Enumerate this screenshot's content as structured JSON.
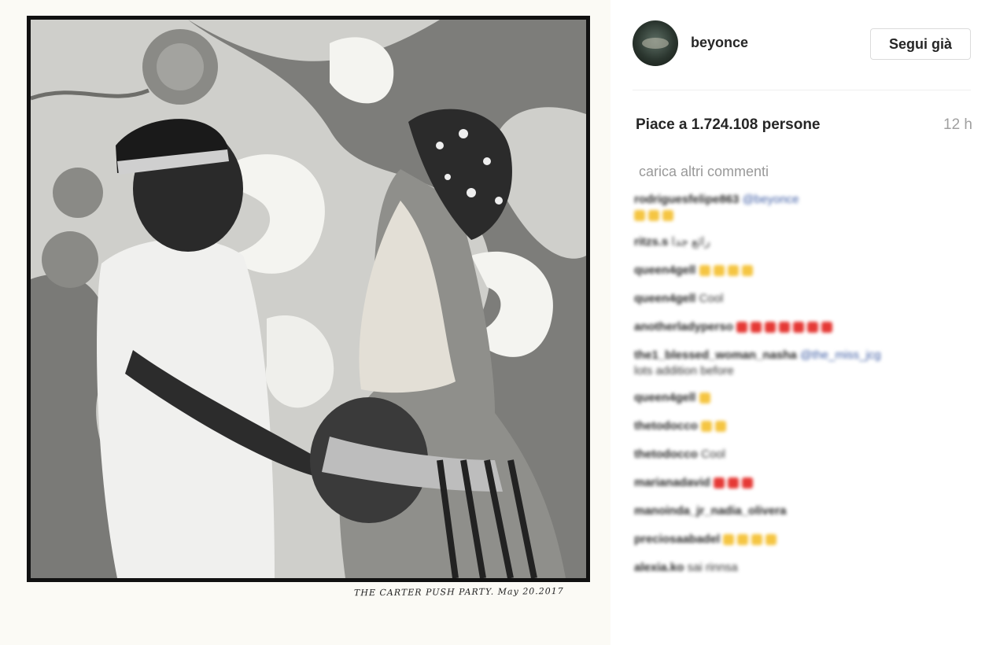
{
  "photo": {
    "caption": "THE CARTER PUSH PARTY. May 20.2017"
  },
  "post": {
    "username": "beyonce",
    "follow_label": "Segui già",
    "likes_text": "Piace a 1.724.108 persone",
    "time": "12 h",
    "load_more": "carica altri commenti"
  },
  "comments": [
    {
      "user": "rodriguesfelipe863",
      "mention": "@beyonce",
      "text": "",
      "emoji_color": "#f5c542",
      "emoji_count": 3,
      "two_lines": true
    },
    {
      "user": "ritzs.s",
      "mention": "",
      "text": "رائع جدا",
      "emoji_color": "",
      "emoji_count": 0,
      "two_lines": false
    },
    {
      "user": "queen4gell",
      "mention": "",
      "text": "",
      "emoji_color": "#f5c542",
      "emoji_count": 4,
      "two_lines": false
    },
    {
      "user": "queen4gell",
      "mention": "",
      "text": "Cool",
      "emoji_color": "",
      "emoji_count": 0,
      "two_lines": false
    },
    {
      "user": "anotherladyperso",
      "mention": "",
      "text": "",
      "emoji_color": "#e53935",
      "emoji_count": 7,
      "two_lines": false
    },
    {
      "user": "the1_blessed_woman_nasha",
      "mention": "@the_miss_jcg",
      "text": "lots addition before",
      "emoji_color": "",
      "emoji_count": 0,
      "two_lines": true
    },
    {
      "user": "queen4gell",
      "mention": "",
      "text": "",
      "emoji_color": "#f5c542",
      "emoji_count": 1,
      "two_lines": false
    },
    {
      "user": "thetodocco",
      "mention": "",
      "text": "",
      "emoji_color": "#f5c542",
      "emoji_count": 2,
      "two_lines": false
    },
    {
      "user": "thetodocco",
      "mention": "",
      "text": "Cool",
      "emoji_color": "",
      "emoji_count": 0,
      "two_lines": false
    },
    {
      "user": "marianadavid",
      "mention": "",
      "text": "",
      "emoji_color": "#e53935",
      "emoji_count": 3,
      "two_lines": false
    },
    {
      "user": "manoinda_jr_nadia_olivera",
      "mention": "",
      "text": "",
      "emoji_color": "",
      "emoji_count": 0,
      "two_lines": false
    },
    {
      "user": "preciosaabadel",
      "mention": "",
      "text": "",
      "emoji_color": "#f5c542",
      "emoji_count": 4,
      "two_lines": false
    },
    {
      "user": "alexia.ko",
      "mention": "",
      "text": "sai rinnsa",
      "emoji_color": "",
      "emoji_count": 0,
      "two_lines": false
    }
  ]
}
